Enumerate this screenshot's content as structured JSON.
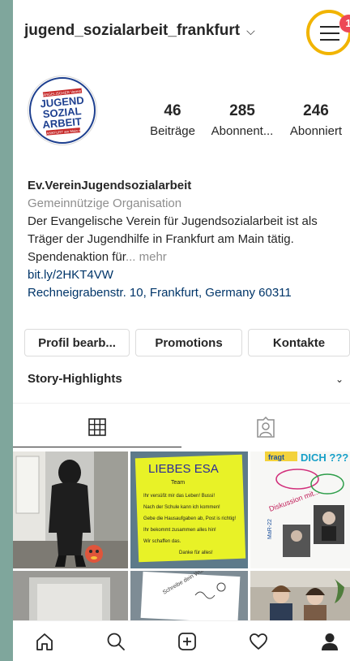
{
  "header": {
    "username": "jugend_sozialarbeit_frankfurt",
    "dropdown_icon": "chevron-down-icon",
    "menu_badge": "1"
  },
  "profile": {
    "avatar_text": {
      "top": "EVANGELISCHER Verein für",
      "line1": "JUGEND",
      "line2": "SOZIAL",
      "line3": "ARBEIT",
      "bottom": "FRANKFURT am Main e.V."
    },
    "stats": [
      {
        "value": "46",
        "label": "Beiträge"
      },
      {
        "value": "285",
        "label": "Abonnent..."
      },
      {
        "value": "246",
        "label": "Abonniert"
      }
    ]
  },
  "bio": {
    "name": "Ev.VereinJugendsozialarbeit",
    "category": "Gemeinnützige Organisation",
    "description": "Der Evangelische Verein für Jugendsozialarbeit ist als Träger der Jugendhilfe in Frankfurt am Main tätig. Spendenaktion für",
    "more": "... mehr",
    "link": "bit.ly/2HKT4VW",
    "address": "Rechneigrabenstr. 10, Frankfurt, Germany 60311"
  },
  "actions": {
    "edit_profile": "Profil bearb...",
    "promotions": "Promotions",
    "contacts": "Kontakte"
  },
  "highlights": {
    "label": "Story-Highlights"
  },
  "posts": {
    "post2": {
      "title": "LIEBES ESA",
      "line0": "Team",
      "line1": "Ihr versüßt mir das Leben! Bussi!",
      "line2": "Nach der Schule kann ich kommen!",
      "line3": "Gebe die Hausaufgaben ab, Post is richtig!",
      "line4": "Ihr bekommt zusammen alles hin!",
      "line5": "Wir schaffen das.",
      "line6": "Danke für alles!"
    },
    "post3": {
      "word1": "fragt",
      "word2": "DICH ???",
      "word3": "Diskussion mit...",
      "word4": "MaR-22"
    },
    "post5": {
      "caption": "Schreibe dein Wunsch"
    }
  },
  "colors": {
    "accent_ring": "#f1b400",
    "badge": "#ed4956",
    "link": "#003569"
  },
  "nav": {
    "items": [
      "home-icon",
      "search-icon",
      "add-post-icon",
      "activity-heart-icon",
      "profile-icon"
    ]
  }
}
